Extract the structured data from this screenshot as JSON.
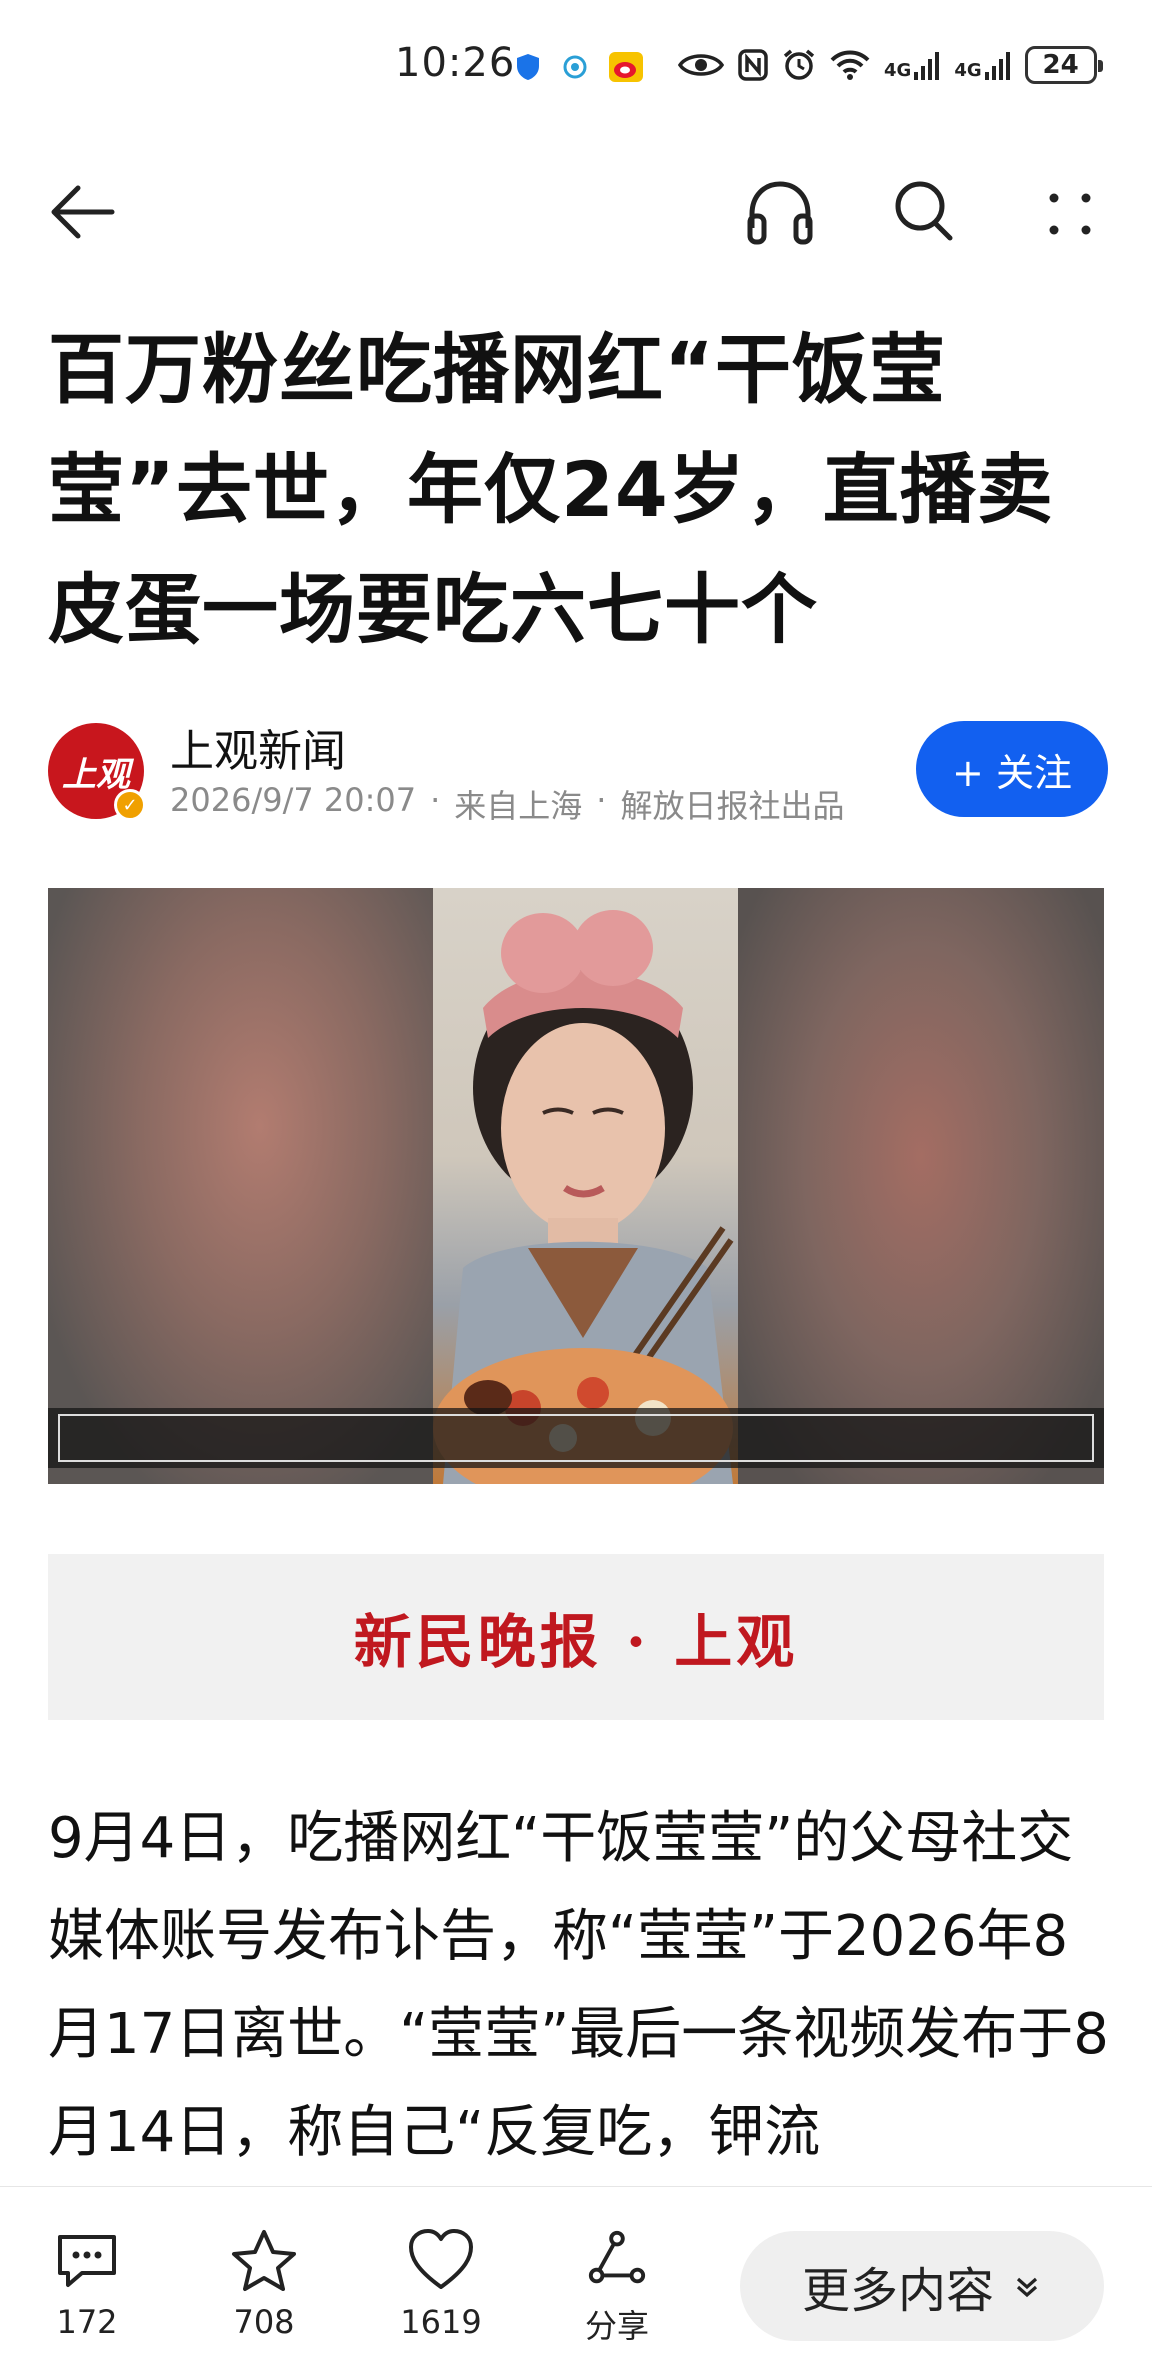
{
  "status_bar": {
    "time": "10:26",
    "network_1": "4G",
    "network_2": "4G",
    "battery": "24"
  },
  "nav": {
    "icons": [
      "back-arrow-icon",
      "headphones-icon",
      "search-icon",
      "more-icon"
    ]
  },
  "article": {
    "title": "百万粉丝吃播网红“干饭莹莹”去世，年仅24岁，直播卖皮蛋一场要吃六七十个",
    "source": {
      "name": "上观新闻",
      "avatar_text": "上观",
      "date": "2026/9/7 20:07",
      "location": "来自上海",
      "publisher": "解放日报社出品"
    },
    "follow_label": "+ 关注",
    "masthead": "新民晚报 · 上观",
    "body": "9月4日，吃播网红“干饭莹莹”的父母社交媒体账号发布讣告，称“莹莹”于2026年8月17日离世。“莹莹”最后一条视频发布于8月14日，称自己“反复吃，钾流"
  },
  "bottom_bar": {
    "comments": "172",
    "favorites": "708",
    "likes": "1619",
    "share_label": "分享",
    "more_label": "更多内容"
  },
  "colors": {
    "accent_blue": "#1260f0",
    "brand_red": "#c8161d",
    "masthead_red": "#c0181f"
  }
}
